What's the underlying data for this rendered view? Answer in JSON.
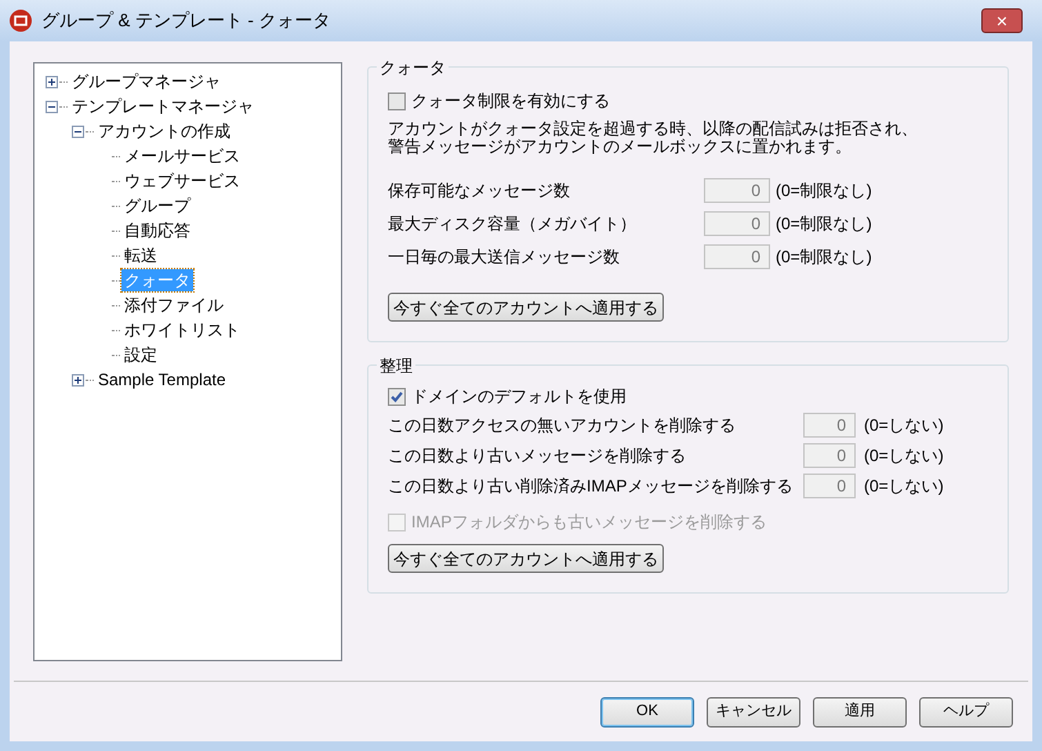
{
  "window": {
    "title": "グループ & テンプレート - クォータ",
    "close": "×"
  },
  "tree": [
    {
      "label": "グループマネージャ",
      "expanded": false,
      "selected": false
    },
    {
      "label": "テンプレートマネージャ",
      "expanded": true,
      "selected": false,
      "children": [
        {
          "label": "アカウントの作成",
          "expanded": true,
          "selected": false,
          "children": [
            {
              "label": "メールサービス",
              "selected": false
            },
            {
              "label": "ウェブサービス",
              "selected": false
            },
            {
              "label": "グループ",
              "selected": false
            },
            {
              "label": "自動応答",
              "selected": false
            },
            {
              "label": "転送",
              "selected": false
            },
            {
              "label": "クォータ",
              "selected": true
            },
            {
              "label": "添付ファイル",
              "selected": false
            },
            {
              "label": "ホワイトリスト",
              "selected": false
            },
            {
              "label": "設定",
              "selected": false
            }
          ]
        },
        {
          "label": "Sample Template",
          "expanded": false,
          "selected": false
        }
      ]
    }
  ],
  "quota": {
    "title": "クォータ",
    "enable": {
      "label": "クォータ制限を有効にする",
      "checked": false,
      "disabled": false
    },
    "description": [
      "アカウントがクォータ設定を超過する時、以降の配信試みは拒否され、",
      "警告メッセージがアカウントのメールボックスに置かれます。"
    ],
    "fields": [
      {
        "label": "保存可能なメッセージ数",
        "value": "0",
        "hint": "(0=制限なし)",
        "disabled": true
      },
      {
        "label": "最大ディスク容量（メガバイト）",
        "value": "0",
        "hint": "(0=制限なし)",
        "disabled": true
      },
      {
        "label": "一日毎の最大送信メッセージ数",
        "value": "0",
        "hint": "(0=制限なし)",
        "disabled": true
      }
    ],
    "apply": "今すぐ全てのアカウントへ適用する"
  },
  "cleanup": {
    "title": "整理",
    "use_default": {
      "label": "ドメインのデフォルトを使用",
      "checked": true,
      "disabled": false
    },
    "fields": [
      {
        "label": "この日数アクセスの無いアカウントを削除する",
        "value": "0",
        "hint": "(0=しない)",
        "disabled": true
      },
      {
        "label": "この日数より古いメッセージを削除する",
        "value": "0",
        "hint": "(0=しない)",
        "disabled": true
      },
      {
        "label": "この日数より古い削除済みIMAPメッセージを削除する",
        "value": "0",
        "hint": "(0=しない)",
        "disabled": true
      }
    ],
    "imap": {
      "label": "IMAPフォルダからも古いメッセージを削除する",
      "checked": false,
      "disabled": true
    },
    "apply": "今すぐ全てのアカウントへ適用する"
  },
  "buttons": [
    {
      "label": "OK",
      "default": true
    },
    {
      "label": "キャンセル",
      "default": false
    },
    {
      "label": "適用",
      "default": false
    },
    {
      "label": "ヘルプ",
      "default": false
    }
  ]
}
